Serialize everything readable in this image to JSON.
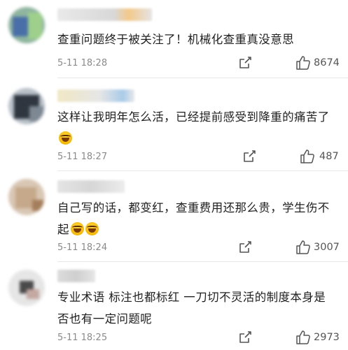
{
  "comments": [
    {
      "text": "查重问题终于被关注了！机械化查重真没意思",
      "time": "5-11 18:28",
      "likes": "8674",
      "share_icon": "share-icon",
      "like_icon": "thumbs-up-icon"
    },
    {
      "text": "这样让我明年怎么活，已经提前感受到降重的痛苦了",
      "time": "5-11 18:27",
      "likes": "487",
      "emoji": "laugh-cry-emoji"
    },
    {
      "text": "自己写的话，都变红，查重费用还那么贵，学生伤不起",
      "time": "5-11 18:24",
      "likes": "3007",
      "emoji": "laugh-cry-emoji"
    },
    {
      "text": "专业术语  标注也都标红  一刀切不灵活的制度本身是否也有一定问题呢",
      "time": "5-11 18:25",
      "likes": "2973"
    }
  ]
}
